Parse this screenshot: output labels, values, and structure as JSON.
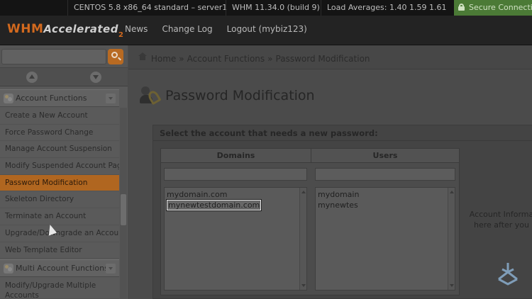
{
  "topbar": {
    "os_info": "CENTOS 5.8 x86_64 standard – server1",
    "whm_version": "WHM 11.34.0 (build 9)",
    "load_averages": "Load Averages: 1.40 1.59 1.61",
    "secure_label": "Secure Connecti"
  },
  "header": {
    "logo_whm": "WHM",
    "logo_accelerated": "Accelerated",
    "logo_num": "2",
    "nav": [
      "News",
      "Change Log",
      "Logout (mybiz123)"
    ]
  },
  "sidebar": {
    "search_placeholder": "",
    "group1": "Account Functions",
    "items": [
      "Create a New Account",
      "Force Password Change",
      "Manage Account Suspension",
      "Modify Suspended Account Page",
      "Password Modification",
      "Skeleton Directory",
      "Terminate an Account",
      "Upgrade/Downgrade an Account",
      "Web Template Editor"
    ],
    "active_index": 4,
    "group2": "Multi Account Functions",
    "items2": [
      "Modify/Upgrade Multiple Accounts"
    ]
  },
  "breadcrumb": {
    "home": "Home",
    "sep": "»",
    "section": "Account Functions",
    "current": "Password Modification"
  },
  "page": {
    "title": "Password Modification",
    "panel_heading": "Select the account that needs a new password:",
    "domains_header": "Domains",
    "users_header": "Users",
    "domains": [
      "mydomain.com",
      "mynewtestdomain.com"
    ],
    "selected_domain_index": 1,
    "users": [
      "mydomain",
      "mynewtes"
    ],
    "info_line1": "Account Informa",
    "info_line2": "here after you"
  }
}
